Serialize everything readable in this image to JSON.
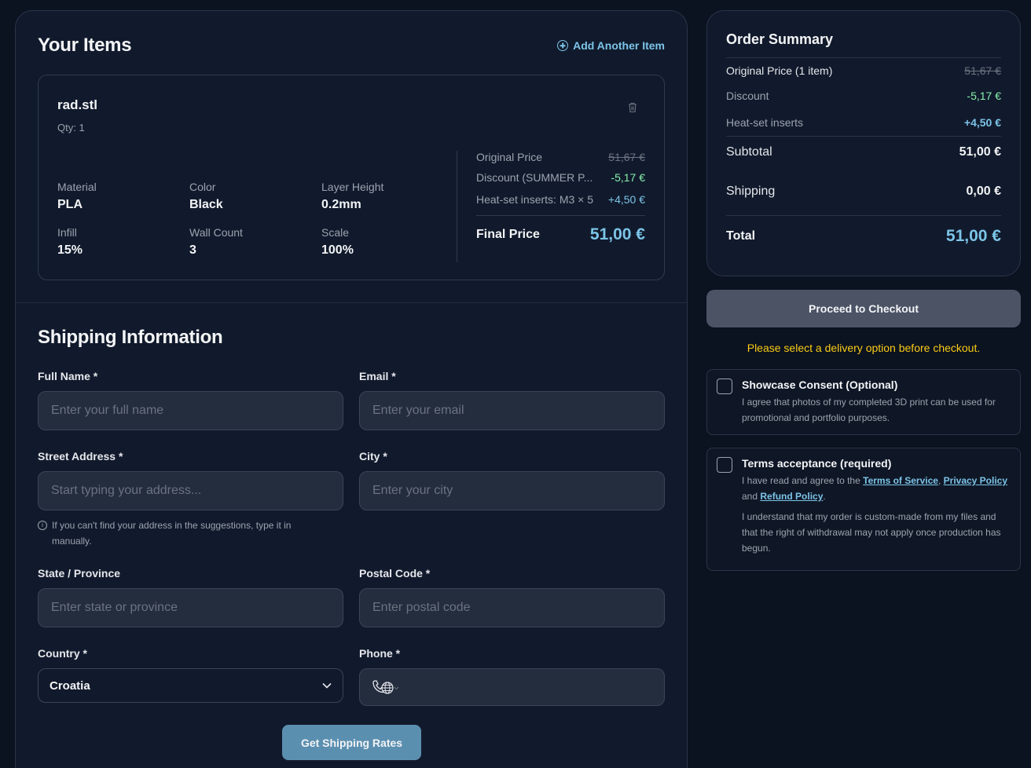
{
  "items_section": {
    "title": "Your Items",
    "add_item_label": "Add Another Item"
  },
  "item": {
    "name": "rad.stl",
    "qty": "Qty: 1",
    "specs": [
      {
        "label": "Material",
        "value": "PLA"
      },
      {
        "label": "Color",
        "value": "Black"
      },
      {
        "label": "Layer Height",
        "value": "0.2mm"
      },
      {
        "label": "Infill",
        "value": "15%"
      },
      {
        "label": "Wall Count",
        "value": "3"
      },
      {
        "label": "Scale",
        "value": "100%"
      }
    ],
    "price": {
      "original_label": "Original Price",
      "original_value": "51,67 €",
      "discount_label": "Discount (SUMMER P...",
      "discount_value": "-5,17 €",
      "inserts_label": "Heat-set inserts: M3 × 5",
      "inserts_value": "+4,50 €",
      "final_label": "Final Price",
      "final_value": "51,00 €"
    }
  },
  "shipping": {
    "title": "Shipping Information",
    "full_name": {
      "label": "Full Name *",
      "placeholder": "Enter your full name"
    },
    "email": {
      "label": "Email *",
      "placeholder": "Enter your email"
    },
    "street": {
      "label": "Street Address *",
      "placeholder": "Start typing your address...",
      "hint": "If you can't find your address in the suggestions, type it in manually."
    },
    "city": {
      "label": "City *",
      "placeholder": "Enter your city"
    },
    "state": {
      "label": "State / Province",
      "placeholder": "Enter state or province"
    },
    "postal": {
      "label": "Postal Code *",
      "placeholder": "Enter postal code"
    },
    "country": {
      "label": "Country *",
      "value": "Croatia"
    },
    "phone": {
      "label": "Phone *"
    },
    "button_label": "Get Shipping Rates"
  },
  "summary": {
    "title": "Order Summary",
    "original_label": "Original Price (1 item)",
    "original_value": "51,67 €",
    "discount_label": "Discount",
    "discount_value": "-5,17 €",
    "inserts_label": "Heat-set inserts",
    "inserts_value": "+4,50 €",
    "subtotal_label": "Subtotal",
    "subtotal_value": "51,00 €",
    "shipping_label": "Shipping",
    "shipping_value": "0,00 €",
    "total_label": "Total",
    "total_value": "51,00 €"
  },
  "checkout": {
    "button_label": "Proceed to Checkout",
    "warning": "Please select a delivery option before checkout."
  },
  "showcase": {
    "title": "Showcase Consent (Optional)",
    "text": "I agree that photos of my completed 3D print can be used for promotional and portfolio purposes."
  },
  "terms": {
    "title": "Terms acceptance (required)",
    "intro": "I have read and agree to the",
    "tos": "Terms of Service",
    "comma": ",",
    "privacy": "Privacy Policy",
    "and": "and",
    "refund": "Refund Policy",
    "period": ".",
    "note": "I understand that my order is custom-made from my files and that the right of withdrawal may not apply once production has begun."
  },
  "colors": {
    "background": "#0b1220",
    "panel": "#111a2c",
    "accent": "#7cc4e8",
    "discount_green": "#86efac",
    "warning_yellow": "#facc15"
  }
}
